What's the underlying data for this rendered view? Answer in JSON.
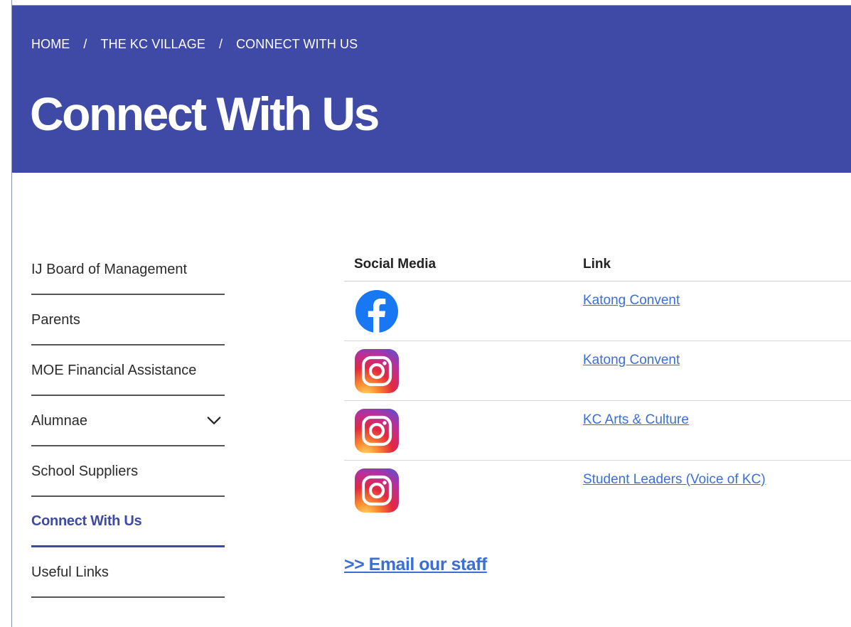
{
  "breadcrumb": {
    "items": [
      "HOME",
      "THE KC VILLAGE",
      "CONNECT WITH US"
    ],
    "separator": "/"
  },
  "page_title": "Connect With Us",
  "sidebar": {
    "items": [
      {
        "label": "IJ Board of Management",
        "expandable": false,
        "active": false
      },
      {
        "label": "Parents",
        "expandable": false,
        "active": false
      },
      {
        "label": "MOE Financial Assistance",
        "expandable": false,
        "active": false
      },
      {
        "label": "Alumnae",
        "expandable": true,
        "active": false
      },
      {
        "label": "School Suppliers",
        "expandable": false,
        "active": false
      },
      {
        "label": "Connect With Us",
        "expandable": false,
        "active": true
      },
      {
        "label": "Useful Links",
        "expandable": false,
        "active": false
      }
    ]
  },
  "social_table": {
    "headers": [
      "Social Media",
      "Link"
    ],
    "rows": [
      {
        "icon": "facebook-icon",
        "link": "Katong Convent"
      },
      {
        "icon": "instagram-icon",
        "link": "Katong Convent"
      },
      {
        "icon": "instagram-icon",
        "link": "KC Arts & Culture"
      },
      {
        "icon": "instagram-icon",
        "link": "Student Leaders (Voice of KC)"
      }
    ]
  },
  "email_link": ">> Email our staff",
  "colors": {
    "hero_bg": "#3e4aa5",
    "link": "#3b6fd6",
    "active_nav": "#3e4aa5",
    "facebook": "#1877f2"
  }
}
